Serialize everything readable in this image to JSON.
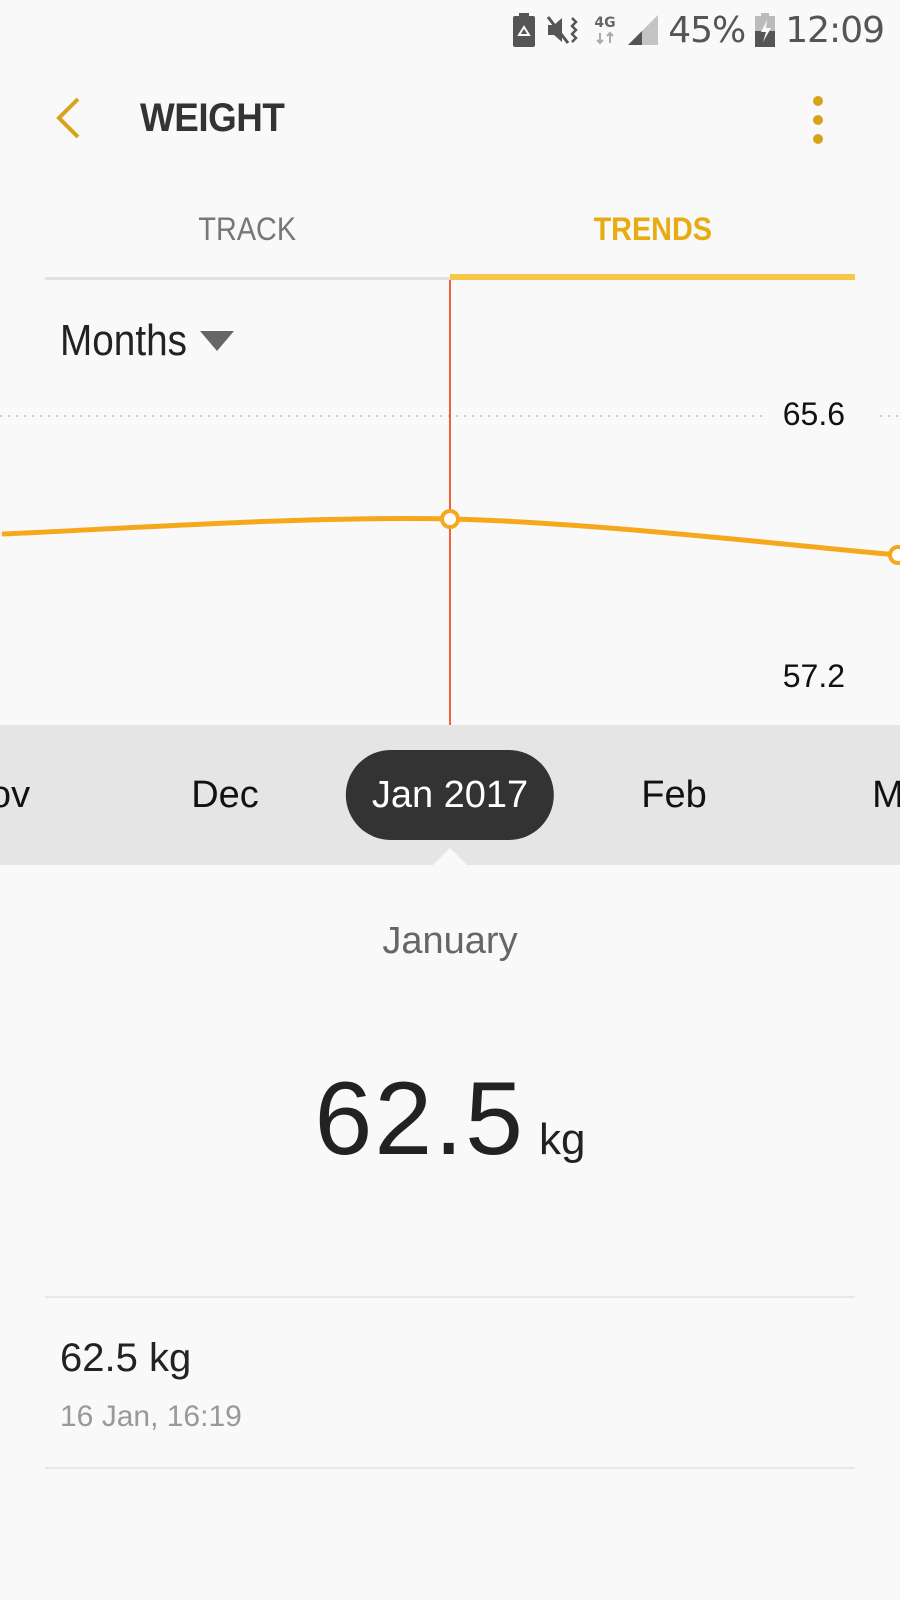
{
  "status_bar": {
    "icons": [
      "battery-saver-icon",
      "mute-vibrate-icon",
      "network-4g-icon",
      "signal-icon",
      "battery-charging-icon"
    ],
    "network_label": "4G",
    "battery_percent": "45%",
    "time": "12:09"
  },
  "app_bar": {
    "title": "WEIGHT",
    "back_icon": "chevron-left-icon",
    "more_icon": "more-vertical-icon"
  },
  "tabs": [
    {
      "label": "TRACK",
      "active": false
    },
    {
      "label": "TRENDS",
      "active": true
    }
  ],
  "period_selector": {
    "value": "Months"
  },
  "colors": {
    "accent": "#e8ab12",
    "tab_underline": "#f8c74a",
    "line": "#f5a81c",
    "cursor_line": "#f2613f",
    "pill": "#333333",
    "strip": "#e5e5e5"
  },
  "chart_data": {
    "type": "line",
    "title": "",
    "xlabel": "",
    "ylabel": "kg",
    "categories": [
      "Dec",
      "Jan 2017",
      "Feb"
    ],
    "series": [
      {
        "name": "Weight",
        "values": [
          62.0,
          62.5,
          61.3
        ]
      }
    ],
    "y_ticks": [
      "65.6",
      "57.2"
    ],
    "ylim": [
      57.2,
      65.6
    ],
    "selected_category": "Jan 2017",
    "grid": "dotted line at 65.6"
  },
  "month_scroller": {
    "items": [
      "Nov",
      "Dec",
      "Jan 2017",
      "Feb",
      "Mar"
    ],
    "visible_text": [
      "ov",
      "Dec",
      "Jan 2017",
      "Feb",
      "M"
    ],
    "selected_index": 2
  },
  "summary": {
    "month": "January",
    "value": "62.5",
    "unit": "kg"
  },
  "records": [
    {
      "value": "62.5 kg",
      "timestamp": "16 Jan, 16:19"
    }
  ]
}
